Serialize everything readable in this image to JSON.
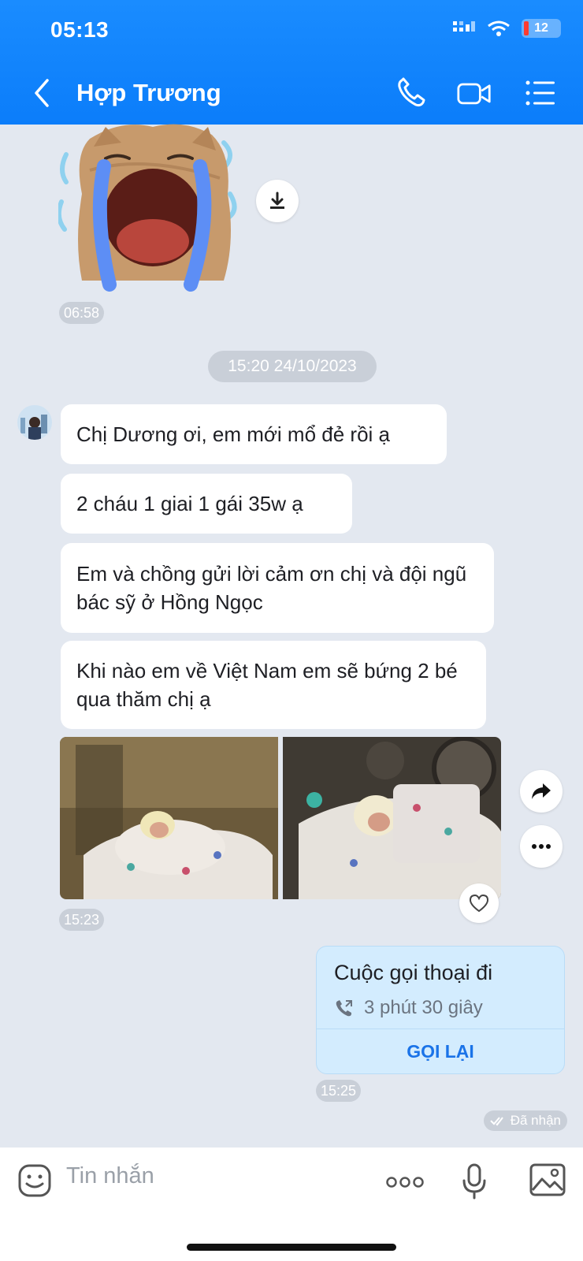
{
  "status_bar": {
    "time": "05:13",
    "battery": "12"
  },
  "header": {
    "contact_name": "Hợp Trương"
  },
  "icons": {
    "back": "chevron-left-icon",
    "call": "phone-icon",
    "video": "video-camera-icon",
    "menu": "list-menu-icon",
    "download": "download-icon",
    "forward": "forward-icon",
    "more": "more-icon",
    "heart": "heart-icon",
    "emoji": "emoji-icon",
    "mic": "microphone-icon",
    "gallery": "image-icon"
  },
  "messages": {
    "sticker_time": "06:58",
    "date_separator": "15:20 24/10/2023",
    "texts": [
      "Chị Dương ơi, em mới mổ đẻ rồi ạ",
      "2 cháu 1 giai 1 gái 35w ạ",
      "Em và chồng gửi lời cảm ơn chị và đội ngũ bác sỹ ở Hồng Ngọc",
      "Khi nào em về Việt Nam em sẽ bứng 2 bé qua thăm chị ạ"
    ],
    "photos_time": "15:23",
    "call": {
      "title": "Cuộc gọi thoại đi",
      "duration": "3 phút 30 giây",
      "call_back": "GỌI LẠI"
    },
    "call_time": "15:25",
    "received_status": "Đã nhận"
  },
  "composer": {
    "placeholder": "Tin nhắn",
    "more": "ooo"
  },
  "colors": {
    "header": "#0b7dfa",
    "call_card": "#d3ecfe",
    "call_back": "#1a73e8",
    "chat_bg": "#e3e8f0"
  }
}
